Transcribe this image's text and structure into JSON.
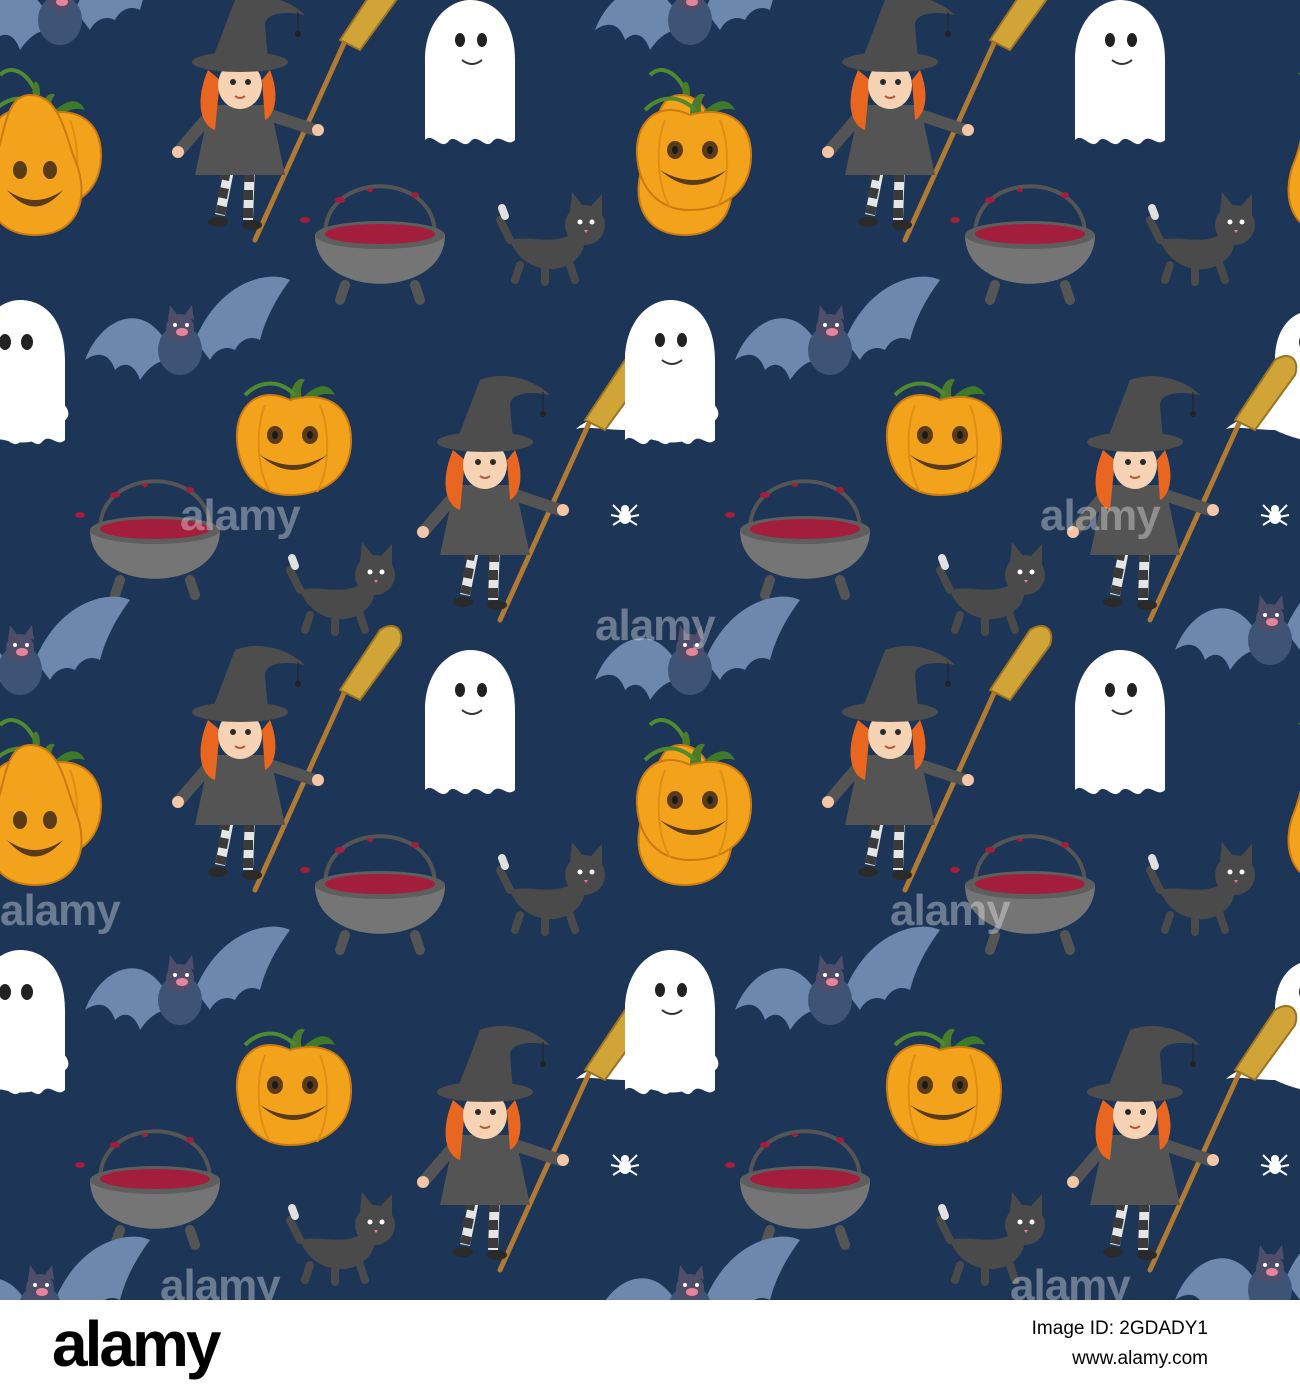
{
  "image": {
    "background_color": "#1d3557",
    "subjects": [
      "witch-with-broom",
      "ghost",
      "jack-o-lantern-pumpkin",
      "cauldron",
      "black-cat",
      "bat",
      "spider"
    ],
    "palette": {
      "navy": "#1d3557",
      "pumpkin": "#f3a21b",
      "ghost": "#ffffff",
      "cauldron": "#727272",
      "potion": "#a31d3c",
      "cat": "#4a4a4a",
      "bat": "#6d87ad",
      "hair": "#e8661f",
      "broom": "#d1a437"
    }
  },
  "watermark": {
    "text": "alamy"
  },
  "footer": {
    "logo": "alamy",
    "image_id": "Image ID: 2GDADY1",
    "url": "www.alamy.com"
  }
}
